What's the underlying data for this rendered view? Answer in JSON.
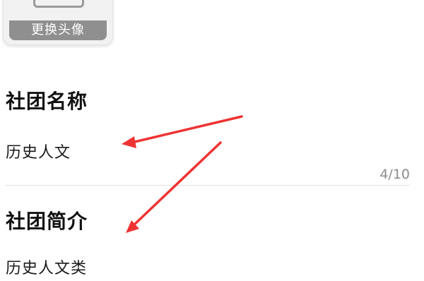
{
  "avatar": {
    "caption": "更换头像"
  },
  "club_name": {
    "title": "社团名称",
    "value": "历史人文",
    "counter": "4/10"
  },
  "club_intro": {
    "title": "社团简介",
    "value": "历史人文类"
  },
  "colors": {
    "arrow": "#ee3333",
    "divider": "#e2e2e2",
    "counter_text": "#8c8c8c",
    "avatar_caption_bg": "#8f8f8f"
  },
  "icons": {
    "avatar_placeholder": "image-placeholder-icon",
    "annotation": "red-arrow-icon"
  }
}
